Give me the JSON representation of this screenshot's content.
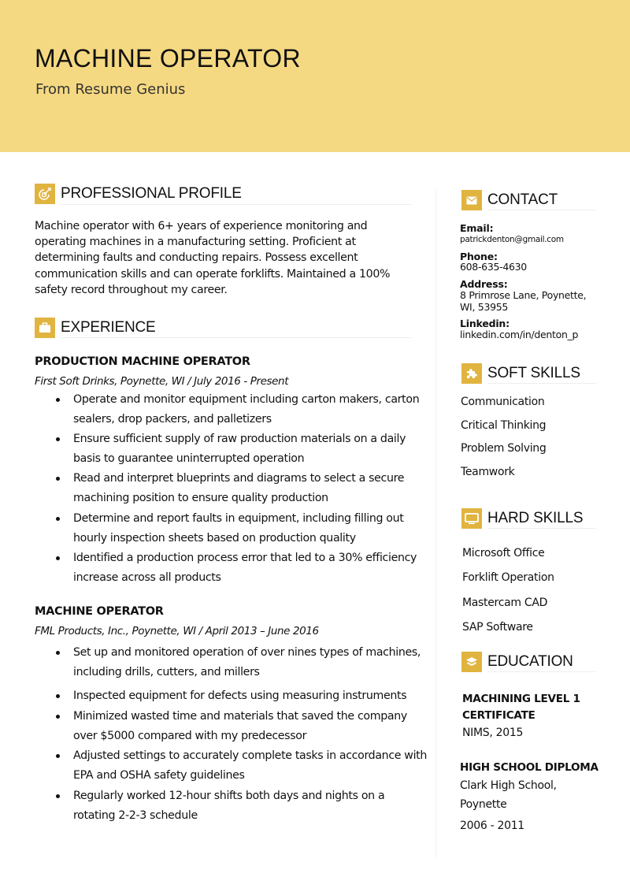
{
  "header": {
    "title": "MACHINE OPERATOR",
    "subtitle": "From Resume Genius"
  },
  "colors": {
    "header_bg": "#f5d982",
    "accent": "#e1b440",
    "text": "#111111"
  },
  "profile": {
    "heading": "PROFESSIONAL PROFILE",
    "icon": "target-icon",
    "lines": [
      "Machine operator with 6+ years of experience monitoring and",
      "operating machines in a manufacturing setting. Proficient at",
      "determining faults and conducting repairs. Possess excellent",
      "communication skills and can operate forklifts. Maintained a 100%",
      "safety record throughout my career."
    ]
  },
  "experience": {
    "heading": "EXPERIENCE",
    "icon": "briefcase-icon",
    "jobs": [
      {
        "title": "PRODUCTION MACHINE OPERATOR",
        "meta": "First Soft Drinks, Poynette, WI  /  July 2016 - Present",
        "bullets": [
          [
            "Operate and monitor equipment including carton makers, carton",
            "sealers, drop packers, and palletizers"
          ],
          [
            "Ensure sufficient supply of raw production materials on a daily",
            "basis to guarantee uninterrupted operation"
          ],
          [
            "Read and interpret blueprints and diagrams to select a secure",
            "machining position to ensure quality production"
          ],
          [
            "Determine and report faults in equipment, including filling out",
            "hourly inspection sheets based on production quality"
          ],
          [
            "Identified a production process error that led to a 30% efficiency",
            "increase across all products"
          ]
        ]
      },
      {
        "title": "MACHINE OPERATOR",
        "meta": "FML Products, Inc., Poynette, WI  /  April 2013 – June 2016",
        "bullets": [
          [
            "Set up and monitored operation of over nines types of machines,",
            "including drills, cutters, and millers"
          ],
          [
            "Inspected equipment for defects using measuring instruments"
          ],
          [
            "Minimized wasted time and materials that saved the company",
            "over $5000 compared with my predecessor"
          ],
          [
            "Adjusted settings to accurately complete tasks in accordance with",
            "EPA and OSHA safety guidelines"
          ],
          [
            "Regularly worked 12-hour shifts both days and nights on a",
            "rotating 2-2-3 schedule"
          ]
        ]
      }
    ]
  },
  "contact": {
    "heading": "CONTACT",
    "icon": "envelope-icon",
    "email_label": "Email:",
    "email": "patrickdenton@gmail.com",
    "phone_label": "Phone:",
    "phone": "608-635-4630",
    "address_label": "Address:",
    "address_lines": [
      "8 Primrose Lane, Poynette,",
      "WI, 53955"
    ],
    "linkedin_label": "Linkedin:",
    "linkedin": "linkedin.com/in/denton_p"
  },
  "soft_skills": {
    "heading": "SOFT SKILLS",
    "icon": "puzzle-icon",
    "items": [
      "Communication",
      "Critical Thinking",
      "Problem Solving",
      "Teamwork"
    ]
  },
  "hard_skills": {
    "heading": "HARD SKILLS",
    "icon": "monitor-icon",
    "items": [
      "Microsoft Office",
      "Forklift Operation",
      "Mastercam CAD",
      "SAP Software"
    ]
  },
  "education": {
    "heading": "EDUCATION",
    "icon": "graduation-cap-icon",
    "entries": [
      {
        "title_lines": [
          "MACHINING LEVEL 1",
          "CERTIFICATE"
        ],
        "detail_lines": [
          "NIMS, 2015"
        ]
      },
      {
        "title_lines": [
          "HIGH SCHOOL DIPLOMA"
        ],
        "detail_lines": [
          "Clark High School,",
          "Poynette",
          "2006 - 2011"
        ]
      }
    ]
  }
}
